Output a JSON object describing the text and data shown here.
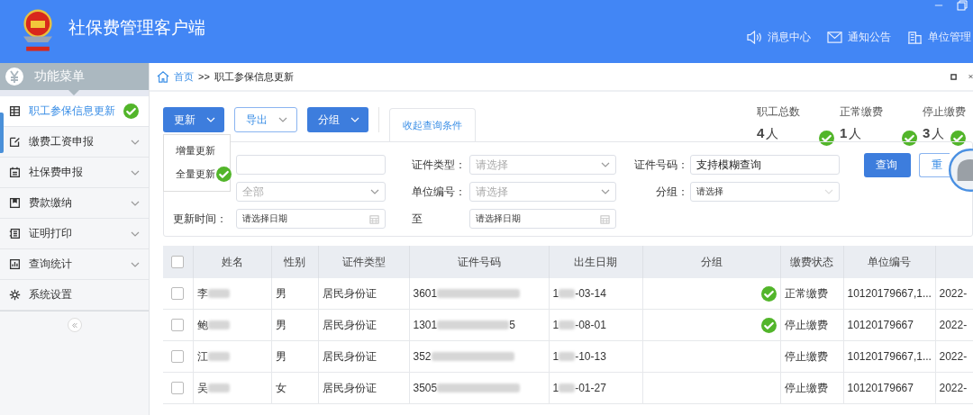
{
  "app": {
    "title": "社保费管理客户端"
  },
  "header_links": [
    {
      "kind": "speaker",
      "label": "消息中心"
    },
    {
      "kind": "mail",
      "label": "通知公告"
    },
    {
      "kind": "building",
      "label": "单位管理"
    }
  ],
  "sidebar": {
    "title": "功能菜单",
    "items": [
      {
        "label": "职工参保信息更新",
        "kind": "table",
        "selected": true,
        "expandable": false,
        "annotated": true
      },
      {
        "label": "缴费工资申报",
        "kind": "edit",
        "selected": false,
        "expandable": true,
        "annotated": false
      },
      {
        "label": "社保费申报",
        "kind": "clipboard",
        "selected": false,
        "expandable": true,
        "annotated": false
      },
      {
        "label": "费款缴纳",
        "kind": "book",
        "selected": false,
        "expandable": true,
        "annotated": false
      },
      {
        "label": "证明打印",
        "kind": "list",
        "selected": false,
        "expandable": true,
        "annotated": false
      },
      {
        "label": "查询统计",
        "kind": "chart",
        "selected": false,
        "expandable": true,
        "annotated": false
      },
      {
        "label": "系统设置",
        "kind": "gear",
        "selected": false,
        "expandable": false,
        "annotated": false
      }
    ]
  },
  "breadcrumb": {
    "home": "首页",
    "separator": ">>",
    "current": "职工参保信息更新"
  },
  "toolbar": {
    "buttons": [
      {
        "label": "更新",
        "kind": "primary"
      },
      {
        "label": "导出",
        "kind": "outline"
      },
      {
        "label": "分组",
        "kind": "primary"
      }
    ],
    "toggle_tab": "收起查询条件"
  },
  "update_menu": {
    "items": [
      {
        "label": "增量更新",
        "annotated": false
      },
      {
        "label": "全量更新",
        "annotated": true
      }
    ]
  },
  "stats": [
    {
      "label": "职工总数",
      "number": "4",
      "unit": "人",
      "annotated": true
    },
    {
      "label": "正常缴费",
      "number": "1",
      "unit": "人",
      "annotated": true
    },
    {
      "label": "停止缴费",
      "number": "3",
      "unit": "人",
      "annotated": true
    }
  ],
  "filters": [
    {
      "kind": "input"
    },
    {
      "label": "证件类型：",
      "kind": "select",
      "placeholder": "请选择"
    },
    {
      "label": "证件号码：",
      "kind": "input",
      "value": "支持模糊查询"
    },
    {
      "kind": "select",
      "placeholder": "全部"
    },
    {
      "label": "单位编号：",
      "kind": "select",
      "placeholder": "请选择"
    },
    {
      "label": "分组：",
      "kind": "select",
      "placeholder": "请选择",
      "disabled": true
    },
    {
      "label": "更新时间：",
      "kind": "date",
      "placeholder": "请选择日期"
    },
    {
      "label": "至",
      "kind": "date",
      "placeholder": "请选择日期"
    }
  ],
  "query_buttons": [
    {
      "label": "查询",
      "kind": "primary"
    },
    {
      "label": "重",
      "kind": "outline"
    }
  ],
  "table": {
    "all_checked": false,
    "columns": [
      "姓名",
      "性别",
      "证件类型",
      "证件号码",
      "出生日期",
      "分组",
      "缴费状态",
      "单位编号"
    ],
    "rows": [
      {
        "checked": false,
        "name": "李",
        "gender": "男",
        "id_type": "居民身份证",
        "id_number": "3601",
        "birth_prefix": "1",
        "birth": "-03-14",
        "group_annotated": true,
        "status": "正常缴费",
        "unit": "10120179667,1...",
        "column_10": "2022-"
      },
      {
        "checked": false,
        "name": "鲍",
        "gender": "男",
        "id_type": "居民身份证",
        "id_number": "1301",
        "id_tail": "5",
        "birth_prefix": "1",
        "birth": "-08-01",
        "group_annotated": true,
        "status": "停止缴费",
        "unit": "10120179667",
        "column_10": "2022-"
      },
      {
        "checked": false,
        "name": "江",
        "gender": "男",
        "id_type": "居民身份证",
        "id_number": "352",
        "birth_prefix": "1",
        "birth": "-10-13",
        "group_annotated": false,
        "status": "停止缴费",
        "unit": "10120179667,1...",
        "column_10": "2022-"
      },
      {
        "checked": false,
        "name": "吴",
        "gender": "女",
        "id_type": "居民身份证",
        "id_number": "3505",
        "birth_prefix": "1",
        "birth": "-01-27",
        "group_annotated": false,
        "status": "停止缴费",
        "unit": "10120179667",
        "column_10": "2022-"
      }
    ]
  }
}
